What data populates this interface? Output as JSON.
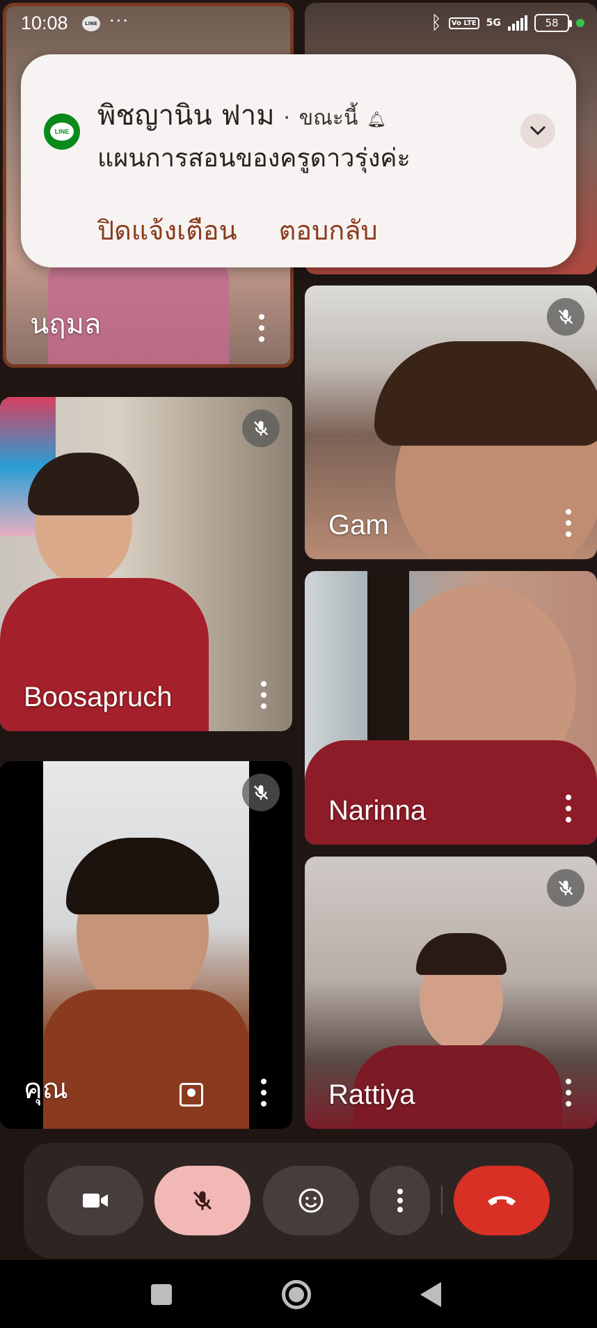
{
  "status_bar": {
    "time": "10:08",
    "app_icon": "line-icon",
    "more": "···",
    "network": "5G",
    "volte": "Vo LTE",
    "battery": "58"
  },
  "notification": {
    "app_label": "LINE",
    "sender": "พิชญานิน ฟาม",
    "separator": "·",
    "time": "ขณะนี้",
    "message": "แผนการสอนของครูดาวรุ่งค่ะ",
    "actions": {
      "dismiss": "ปิดแจ้งเตือน",
      "reply": "ตอบกลับ"
    },
    "accent": "#8a3b1e"
  },
  "participants": [
    {
      "name": "นฤมล",
      "muted": false
    },
    {
      "name": "",
      "muted": false
    },
    {
      "name": "Boosapruch",
      "muted": true
    },
    {
      "name": "Gam",
      "muted": true
    },
    {
      "name": "Narinna",
      "muted": false
    },
    {
      "name": "คุณ",
      "muted": true
    },
    {
      "name": "Rattiya",
      "muted": true
    }
  ],
  "controls": {
    "camera": "camera-icon",
    "microphone": "mic-off-icon",
    "reactions": "emoji-icon",
    "more": "more-options-icon",
    "hangup": "hangup-icon",
    "hangup_color": "#d93025",
    "mic_color": "#f2b8b5"
  }
}
